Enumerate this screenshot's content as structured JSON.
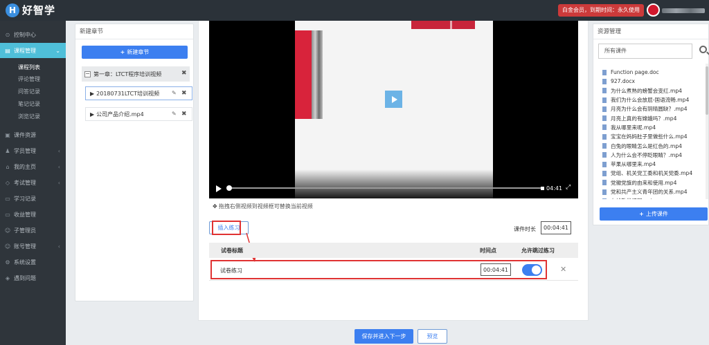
{
  "brand": {
    "badge": "H",
    "name": "好智学"
  },
  "header": {
    "vip": "白金会员，到期时间：永久使用"
  },
  "sidebar": {
    "items": [
      {
        "icon": "⊙",
        "label": "控制中心",
        "arrow": ""
      },
      {
        "icon": "▤",
        "label": "课程管理",
        "arrow": "⌄"
      },
      {
        "icon": "▣",
        "label": "课件资源",
        "arrow": ""
      },
      {
        "icon": "♟",
        "label": "学员管理",
        "arrow": "‹"
      },
      {
        "icon": "⌂",
        "label": "我的主页",
        "arrow": "‹"
      },
      {
        "icon": "◇",
        "label": "考试管理",
        "arrow": "‹"
      },
      {
        "icon": "▭",
        "label": "学习记录",
        "arrow": ""
      },
      {
        "icon": "▭",
        "label": "收益管理",
        "arrow": ""
      },
      {
        "icon": "☺",
        "label": "子管理员",
        "arrow": ""
      },
      {
        "icon": "☺",
        "label": "账号管理",
        "arrow": "‹"
      },
      {
        "icon": "⚙",
        "label": "系统设置",
        "arrow": ""
      },
      {
        "icon": "◈",
        "label": "遇到问题",
        "arrow": ""
      }
    ],
    "subitems": [
      "课程列表",
      "评论管理",
      "问答记录",
      "笔记记录",
      "浏览记录"
    ]
  },
  "chapters": {
    "title": "新建章节",
    "new_btn": "新建章节",
    "chapter": "第一章：LTCT程序培训视频",
    "lessons": [
      "20180731LTCT培训视频",
      "公司产品介绍.mp4"
    ]
  },
  "player": {
    "time": "04:41"
  },
  "editor": {
    "hint": "拖拽右侧视频到视频框可替换当前视频",
    "insert_btn": "插入练习",
    "duration_label": "课件时长",
    "duration": "00:04:41",
    "columns": [
      "试卷标题",
      "时间点",
      "允许跳过练习"
    ],
    "row": {
      "title": "试卷练习",
      "time": "00:04:41",
      "skip": true
    }
  },
  "actions": {
    "save": "保存并进入下一步",
    "preview": "预览"
  },
  "resources": {
    "title": "资源管理",
    "search_placeholder": "所有课件",
    "upload_btn": "上传课件",
    "files": [
      "Function page.doc",
      "927.docx",
      "为什么煮熟的螃蟹会变红.mp4",
      "我们为什么会放屁-国语流畅.mp4",
      "月亮为什么会有阴晴圆缺？.mp4",
      "月亮上真的有嫦娥吗？.mp4",
      "我从哪里来呢.mp4",
      "宝宝在妈妈肚子里做些什么.mp4",
      "白兔的眼睛怎么是红色的.mp4",
      "人为什么会不停眨眼睛？.mp4",
      "苹果从哪里来.mp4",
      "党组、机关党工委和机关党委.mp4",
      "党徽党旗的由来和使用.mp4",
      "党和共产主义青年团的关系.mp4",
      "在线教学课程.pptx"
    ]
  }
}
